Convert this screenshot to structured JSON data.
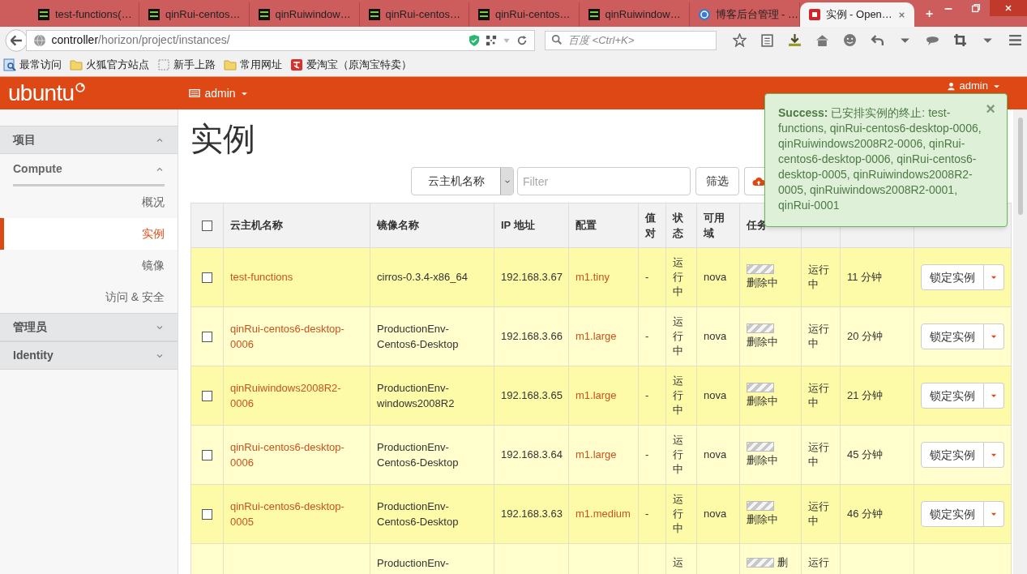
{
  "browser": {
    "tabs": [
      {
        "title": "test-functions(…",
        "kind": "terminal",
        "selected": false
      },
      {
        "title": "qinRui-centos…",
        "kind": "terminal",
        "selected": false
      },
      {
        "title": "qinRuiwindow…",
        "kind": "terminal",
        "selected": false
      },
      {
        "title": "qinRui-centos…",
        "kind": "terminal",
        "selected": false
      },
      {
        "title": "qinRui-centos…",
        "kind": "terminal",
        "selected": false
      },
      {
        "title": "qinRuiwindow…",
        "kind": "terminal",
        "selected": false
      },
      {
        "title": "博客后台管理 - …",
        "kind": "blog",
        "selected": false
      },
      {
        "title": "实例 - Open…",
        "kind": "square",
        "selected": true
      }
    ],
    "url": {
      "host": "controller",
      "path": "/horizon/project/instances/"
    },
    "search": {
      "placeholder": "百度 <Ctrl+K>"
    },
    "bookmarks": [
      {
        "label": "最常访问",
        "kind": "smart"
      },
      {
        "label": "火狐官方站点",
        "kind": "folder"
      },
      {
        "label": "新手上路",
        "kind": "page"
      },
      {
        "label": "常用网址",
        "kind": "folder"
      },
      {
        "label": "爱淘宝（原淘宝特卖）",
        "kind": "taobao"
      }
    ]
  },
  "header": {
    "logo": "ubuntu",
    "project": "admin",
    "user": "admin"
  },
  "sidebar": {
    "sections": [
      {
        "label": "项目",
        "expanded": true,
        "children": [
          {
            "label": "Compute",
            "expanded": true,
            "children": [
              {
                "label": "概况",
                "selected": false
              },
              {
                "label": "实例",
                "selected": true
              },
              {
                "label": "镜像",
                "selected": false
              },
              {
                "label": "访问 & 安全",
                "selected": false
              }
            ]
          }
        ]
      },
      {
        "label": "管理员",
        "expanded": false
      },
      {
        "label": "Identity",
        "expanded": false
      }
    ]
  },
  "page": {
    "title": "实例",
    "filter": {
      "select": "云主机名称",
      "placeholder": "Filter",
      "button": "筛选"
    },
    "table": {
      "select_all": false,
      "columns": [
        "云主机名称",
        "镜像名称",
        "IP 地址",
        "配置",
        "值对",
        "状态",
        "可用域",
        "任务"
      ],
      "rows": [
        {
          "kind": "full",
          "checked": false,
          "name": "test-functions",
          "image": "cirros-0.3.4-x86_64",
          "ip": "192.168.3.67",
          "flavor": "m1.tiny",
          "keypair": "-",
          "status": "运行中",
          "zone": "nova",
          "task": "删除中",
          "power": "运行中",
          "task_bar": {
            "level": 1
          },
          "time": "11 分钟",
          "action": "锁定实例"
        },
        {
          "kind": "full",
          "checked": false,
          "name": "qinRui-centos6-desktop-0006",
          "image": "ProductionEnv-Centos6-Desktop",
          "ip": "192.168.3.66",
          "flavor": "m1.large",
          "keypair": "-",
          "status": "运行中",
          "zone": "nova",
          "task": "删除中",
          "power": "运行中",
          "task_bar": {
            "level": 1
          },
          "time": "20 分钟",
          "action": "锁定实例"
        },
        {
          "kind": "full",
          "checked": false,
          "name": "qinRuiwindows2008R2-0006",
          "image": "ProductionEnv-windows2008R2",
          "ip": "192.168.3.65",
          "flavor": "m1.large",
          "keypair": "-",
          "status": "运行中",
          "zone": "nova",
          "task": "删除中",
          "power": "运行中",
          "task_bar": {
            "level": 1
          },
          "time": "21 分钟",
          "action": "锁定实例"
        },
        {
          "kind": "full",
          "checked": false,
          "name": "qinRui-centos6-desktop-0006",
          "image": "ProductionEnv-Centos6-Desktop",
          "ip": "192.168.3.64",
          "flavor": "m1.large",
          "keypair": "-",
          "status": "运行中",
          "zone": "nova",
          "task": "删除中",
          "power": "运行中",
          "task_bar": {
            "level": 1
          },
          "time": "45 分钟",
          "action": "锁定实例"
        },
        {
          "kind": "full",
          "checked": false,
          "name": "qinRui-centos6-desktop-0005",
          "image": "ProductionEnv-Centos6-Desktop",
          "ip": "192.168.3.63",
          "flavor": "m1.medium",
          "keypair": "-",
          "status": "运行中",
          "zone": "nova",
          "task": "删除中",
          "power": "运行中",
          "task_bar": {
            "level": 1
          },
          "time": "46 分钟",
          "action": "锁定实例"
        },
        {
          "kind": "cut",
          "image": "ProductionEnv-",
          "status": "运",
          "task": "删",
          "task_bar": {
            "level": 1
          },
          "power": "运行"
        }
      ]
    }
  },
  "alert": {
    "kind": "success",
    "message": "**Success:** 已安排实例的终止: test-functions, qinRui-centos6-desktop-0006, qinRuiwindows2008R2-0006, qinRui-centos6-desktop-0006, qinRui-centos6-desktop-0005, qinRuiwindows2008R2-0005, qinRuiwindows2008R2-0001, qinRui-0001",
    "close": "×"
  }
}
